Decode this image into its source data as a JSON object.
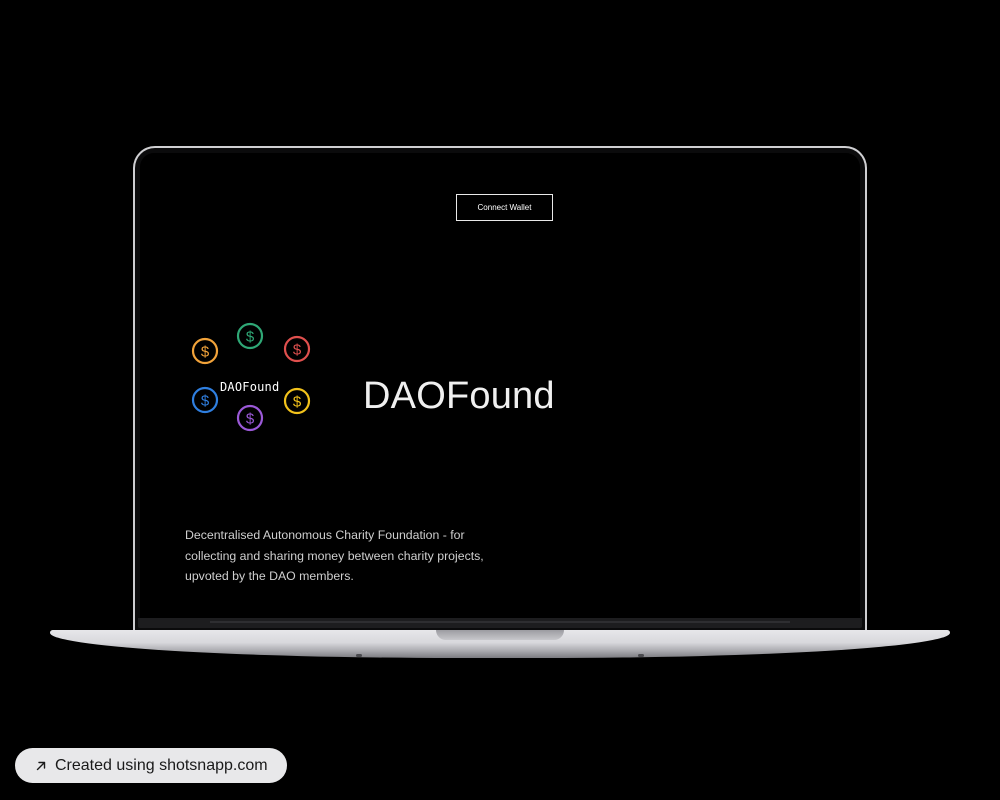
{
  "header": {
    "connect_wallet_label": "Connect Wallet"
  },
  "logo": {
    "text": "DAOFound",
    "coin_symbol": "$",
    "coins": [
      {
        "name": "orange-coin",
        "color": "#f2a33a"
      },
      {
        "name": "green-coin",
        "color": "#2fa876"
      },
      {
        "name": "red-coin",
        "color": "#e0504e"
      },
      {
        "name": "blue-coin",
        "color": "#2f7fe0"
      },
      {
        "name": "yellow-coin",
        "color": "#f2c21b"
      },
      {
        "name": "purple-coin",
        "color": "#9b59d8"
      }
    ]
  },
  "main": {
    "title": "DAOFound",
    "description": "Decentralised Autonomous Charity Foundation - for collecting and sharing money between charity projects, upvoted by the DAO members."
  },
  "watermark": {
    "text": "Created using shotsnapp.com",
    "icon": "arrow-up-right-icon"
  }
}
